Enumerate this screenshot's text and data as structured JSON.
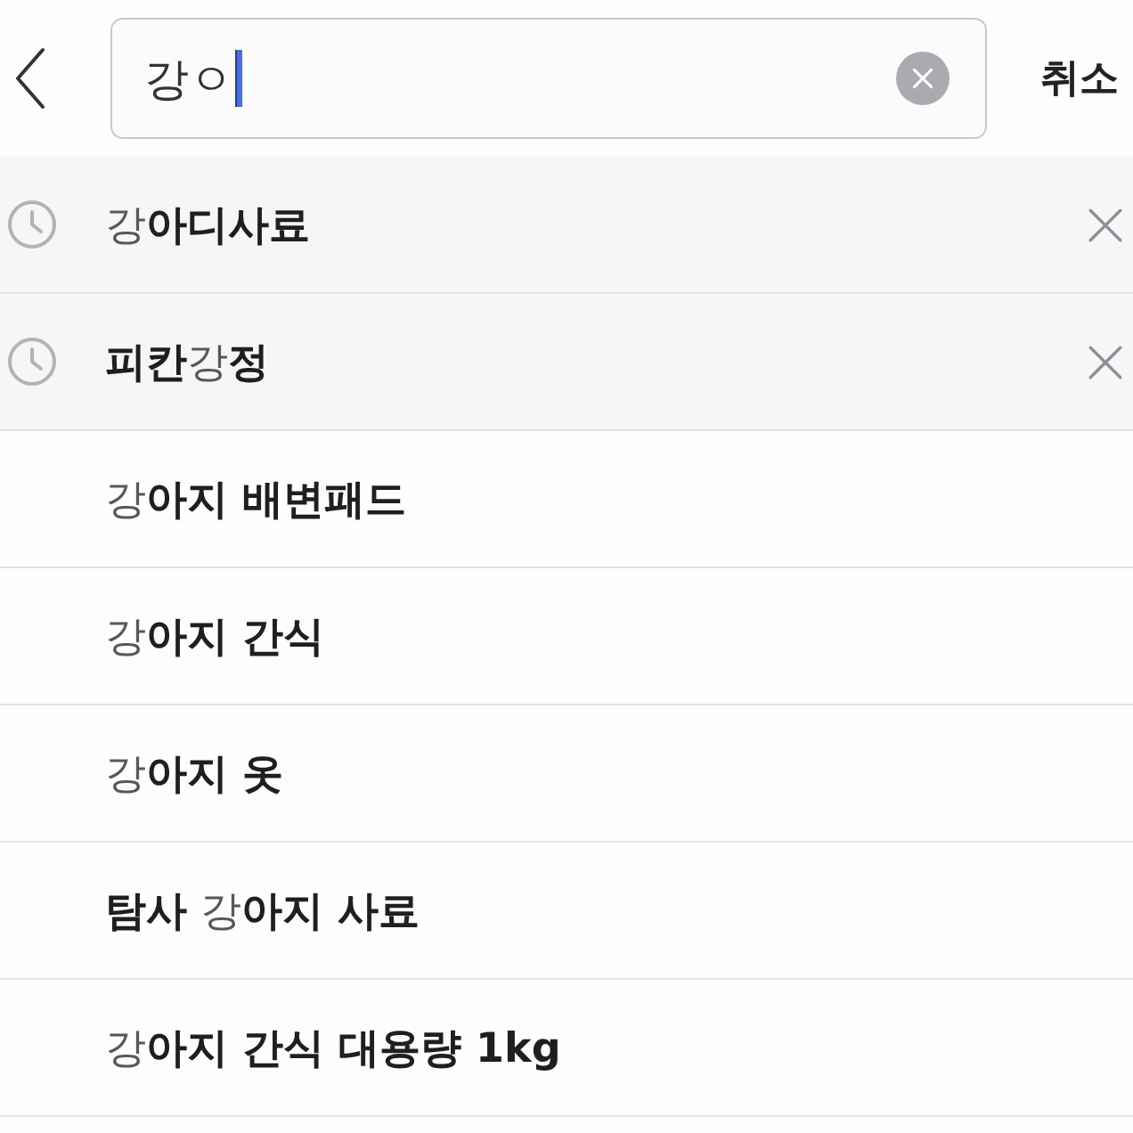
{
  "search": {
    "value": "강ㅇ",
    "focused": true,
    "cancel_label": "취소"
  },
  "items": [
    {
      "kind": "recent",
      "text": "강**아디사료**"
    },
    {
      "kind": "recent",
      "text": "**피칸**강**정**"
    },
    {
      "kind": "suggestion",
      "text": "강**아지 배변패드**"
    },
    {
      "kind": "suggestion",
      "text": "강**아지 간식**"
    },
    {
      "kind": "suggestion",
      "text": "강**아지 옷**"
    },
    {
      "kind": "suggestion",
      "text": "**탐사** 강**아지 사료**"
    },
    {
      "kind": "suggestion",
      "text": "강**아지 간식 대용량 1kg**"
    }
  ]
}
